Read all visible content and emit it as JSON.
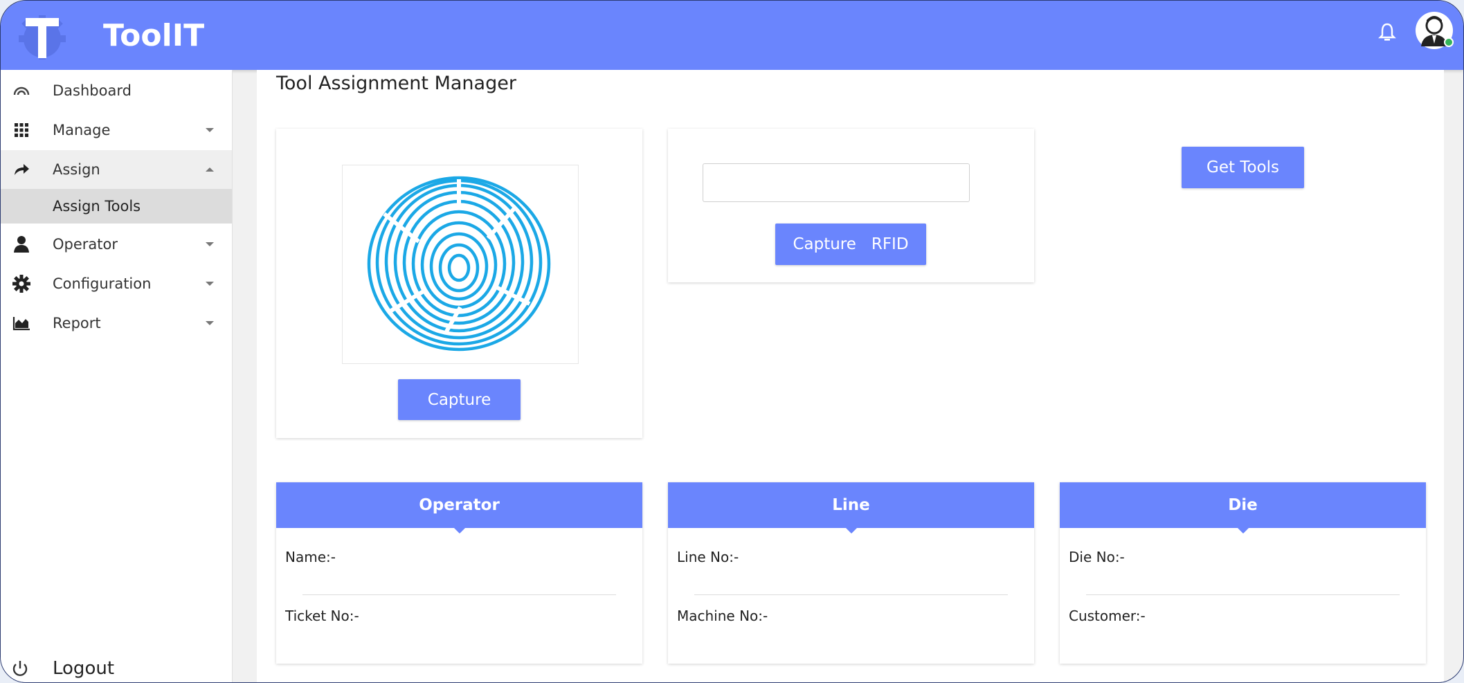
{
  "app": {
    "name": "ToolIT"
  },
  "sidebar": {
    "items": [
      {
        "label": "Dashboard",
        "icon": "dashboard-gauge-icon"
      },
      {
        "label": "Manage",
        "icon": "grid-icon"
      },
      {
        "label": "Assign",
        "icon": "share-arrow-icon"
      },
      {
        "label": "Operator",
        "icon": "user-icon"
      },
      {
        "label": "Configuration",
        "icon": "gear-icon"
      },
      {
        "label": "Report",
        "icon": "area-chart-icon"
      }
    ],
    "submenu": {
      "label": "Assign Tools"
    },
    "logout": {
      "label": "Logout",
      "icon": "power-icon"
    }
  },
  "main": {
    "title": "Tool Assignment Manager",
    "fingerprint": {
      "button_label": "Capture"
    },
    "rfid": {
      "input_value": "",
      "button_label": "Capture   RFID"
    },
    "get_tools_label": "Get Tools",
    "panels": [
      {
        "title": "Operator",
        "row1": "Name:-",
        "row2": "Ticket No:-"
      },
      {
        "title": "Line",
        "row1": "Line No:-",
        "row2": "Machine No:-"
      },
      {
        "title": "Die",
        "row1": "Die No:-",
        "row2": "Customer:-"
      }
    ]
  },
  "colors": {
    "accent": "#6a85fd",
    "fingerprint": "#1ba8e6"
  }
}
